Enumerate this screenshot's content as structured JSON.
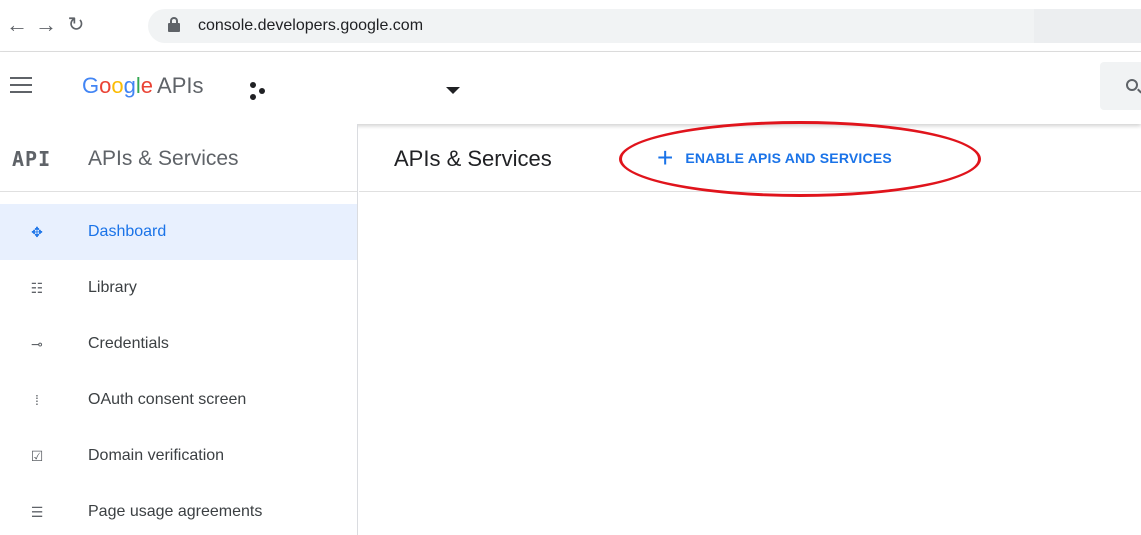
{
  "browser": {
    "url": "console.developers.google.com"
  },
  "header": {
    "brand_google": [
      "G",
      "o",
      "o",
      "g",
      "l",
      "e"
    ],
    "brand_suffix": "APIs"
  },
  "sidebar": {
    "logo": "API",
    "title": "APIs & Services",
    "items": [
      {
        "label": "Dashboard",
        "icon": "dashboard-icon",
        "active": true
      },
      {
        "label": "Library",
        "icon": "library-icon",
        "active": false
      },
      {
        "label": "Credentials",
        "icon": "key-icon",
        "active": false
      },
      {
        "label": "OAuth consent screen",
        "icon": "oauth-icon",
        "active": false
      },
      {
        "label": "Domain verification",
        "icon": "checkbox-icon",
        "active": false
      },
      {
        "label": "Page usage agreements",
        "icon": "settings-list-icon",
        "active": false
      }
    ]
  },
  "main": {
    "title": "APIs & Services",
    "enable_button_label": "ENABLE APIS AND SERVICES"
  },
  "colors": {
    "accent": "#1a73e8",
    "annotation": "#e0141c",
    "active_bg": "#e8f0fe"
  }
}
